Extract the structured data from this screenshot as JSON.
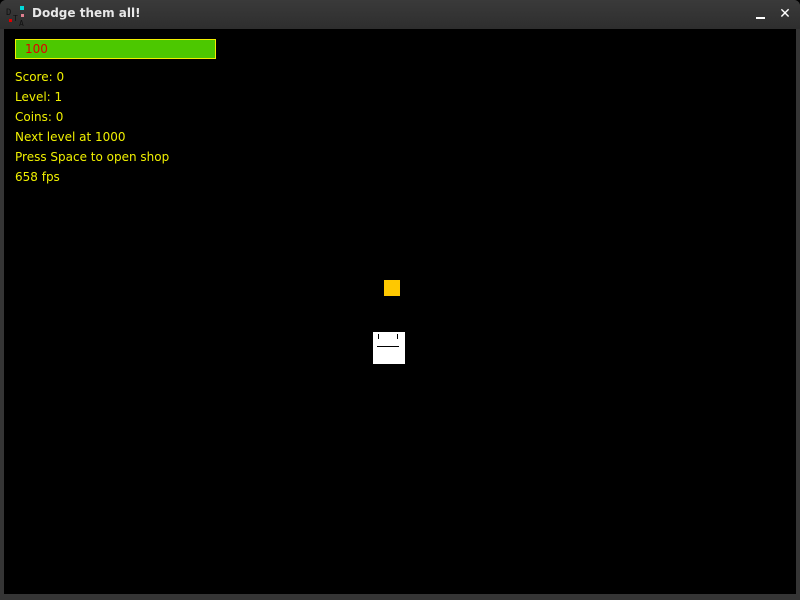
{
  "window": {
    "title": "Dodge them all!",
    "icon": "app-logo-icon",
    "minimize_icon": "minimize-icon",
    "close_icon": "close-icon",
    "close_glyph": "✕"
  },
  "hud": {
    "health": {
      "value": 100,
      "max": 100,
      "label": "100",
      "fill_color": "#4cc800",
      "border_color": "#f0f000",
      "text_color": "#e00000"
    },
    "score": "Score: 0",
    "level": "Level: 1",
    "coins": "Coins: 0",
    "next_level": "Next level at 1000",
    "shop_hint": "Press Space to open shop",
    "fps": "658 fps",
    "text_color": "#f0f000"
  },
  "entities": {
    "coin": {
      "name": "coin",
      "color": "#ffc800"
    },
    "player": {
      "name": "player",
      "color": "#ffffff",
      "expression": "neutral"
    }
  }
}
